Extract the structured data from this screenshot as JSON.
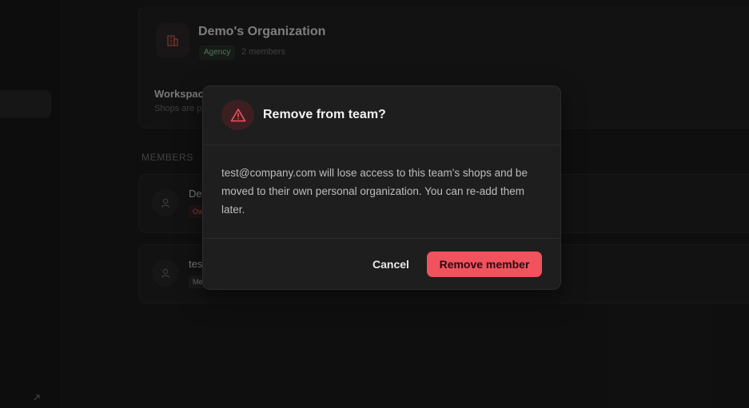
{
  "organization": {
    "name": "Demo's Organization",
    "badge": "Agency",
    "member_count": "2 members"
  },
  "workspace": {
    "title": "Workspac",
    "subtitle": "Shops are p"
  },
  "members_section": {
    "heading": "MEMBERS",
    "members": [
      {
        "name": "De",
        "badge": "Ow"
      },
      {
        "name": "tes",
        "badge": "Me"
      }
    ]
  },
  "dialog": {
    "title": "Remove from team?",
    "body": "test@company.com will lose access to this team's shops and be moved to their own personal organization. You can re-add them later.",
    "cancel_label": "Cancel",
    "confirm_label": "Remove member"
  },
  "colors": {
    "accent_danger": "#f0525e",
    "badge_agency": "#8fc4a0",
    "background": "#171717"
  }
}
